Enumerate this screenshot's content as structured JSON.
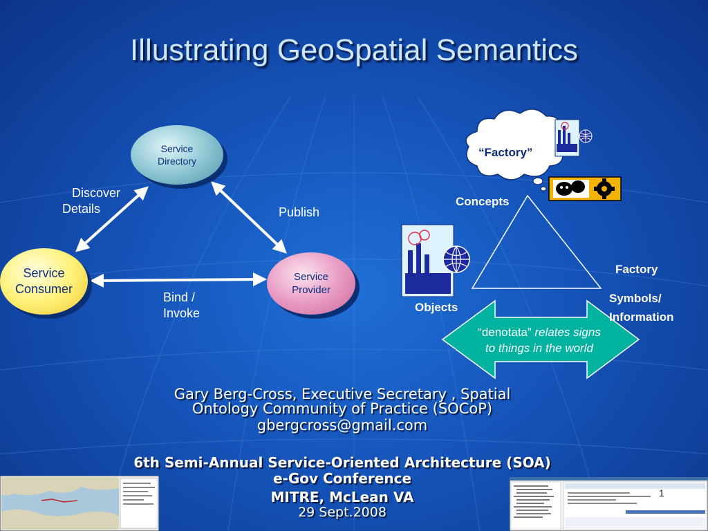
{
  "title": "Illustrating GeoSpatial Semantics",
  "soa_diagram": {
    "service_directory": [
      "Service",
      "Directory"
    ],
    "service_consumer": [
      "Service",
      "Consumer"
    ],
    "service_provider": [
      "Service",
      "Provider"
    ],
    "discover_label": [
      "Discover",
      "Details"
    ],
    "publish_label": "Publish",
    "bind_label": [
      "Bind /",
      "Invoke"
    ]
  },
  "semiotic_triangle": {
    "cloud_text": "“Factory”",
    "concepts": "Concepts",
    "objects": "Objects",
    "symbol_word": "Factory",
    "symbols_label": [
      "Symbols/",
      "Information"
    ],
    "arrow_text": {
      "part1": "“denotata”",
      "part2": " relates signs",
      "part3": "to things in the world"
    }
  },
  "author": {
    "line1": "Gary Berg-Cross, Executive Secretary , Spatial",
    "line2": "Ontology Community of Practice (SOCoP)",
    "email": "gbergcross@gmail.com"
  },
  "conference": {
    "line1": "6th Semi-Annual Service-Oriented Architecture (SOA)",
    "line2": "e-Gov Conference",
    "line3": "MITRE, McLean VA",
    "line4": "29 Sept.2008"
  },
  "page_number": "1",
  "icons": [
    "factory-globe-icon",
    "theater-masks-gear-icon",
    "thought-cloud-icon"
  ],
  "colors": {
    "background": "#1553b8",
    "title": "#cfe6ff",
    "directory": "#8fc7d4",
    "consumer": "#fff17a",
    "provider": "#e99cc3",
    "arrow": "#00b2a0"
  }
}
